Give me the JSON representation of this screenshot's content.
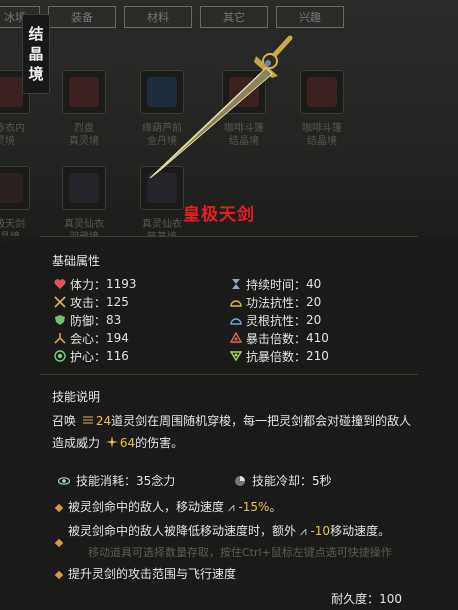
{
  "tabs": [
    "冰境",
    "装备",
    "材料",
    "其它",
    "兴趣"
  ],
  "realm": [
    "结",
    "晶",
    "境"
  ],
  "background_items": [
    {
      "label": "人赤衣内\n灵境"
    },
    {
      "label": "烈盘\n真灵境"
    },
    {
      "label": "缘葫芦前\n金丹境"
    },
    {
      "label": "咖啡斗篷\n结晶境"
    },
    {
      "label": "咖啡斗篷\n结晶境"
    },
    {
      "label": "皇极天剑\n结晶境"
    },
    {
      "label": "真灵仙衣\n羽藏境"
    },
    {
      "label": "真灵仙衣\n筑基境"
    }
  ],
  "item_name": "皇极天剑",
  "base_attr_title": "基础属性",
  "stats_left": [
    {
      "icon": "heart-icon",
      "label": "体力",
      "value": "1193",
      "color": "#e25555"
    },
    {
      "icon": "crossed-swords-icon",
      "label": "攻击",
      "value": "125",
      "color": "#e0b24a"
    },
    {
      "icon": "shield-icon",
      "label": "防御",
      "value": "83",
      "color": "#6fc46f"
    },
    {
      "icon": "triangle-nodes-icon",
      "label": "会心",
      "value": "194",
      "color": "#e39a3a"
    },
    {
      "icon": "protect-heart-icon",
      "label": "护心",
      "value": "116",
      "color": "#7bd07b"
    }
  ],
  "stats_right": [
    {
      "icon": "hourglass-icon",
      "label": "持续时间",
      "value": "40",
      "color": "#8fa6c9"
    },
    {
      "icon": "arc-shield-icon",
      "label": "功法抗性",
      "value": "20",
      "color": "#e0b24a"
    },
    {
      "icon": "spirit-arc-icon",
      "label": "灵根抗性",
      "value": "20",
      "color": "#6fa7e0"
    },
    {
      "icon": "crit-nodes-icon",
      "label": "暴击倍数",
      "value": "410",
      "color": "#e0664a"
    },
    {
      "icon": "anti-crit-icon",
      "label": "抗暴倍数",
      "value": "210",
      "color": "#a6d05a"
    }
  ],
  "skill_title": "技能说明",
  "skill_desc": {
    "pre": "召唤",
    "count": "24",
    "mid": "道灵剑在周围随机穿梭，每一把灵剑都会对碰撞到的敌人造成威力",
    "power": "64",
    "post": "的伤害。"
  },
  "skill_cost": "技能消耗：35念力",
  "skill_cooldown": "技能冷却：5秒",
  "bullets": [
    {
      "pre": "被灵剑命中的敌人，移动速度",
      "val": "-15%",
      "post": "。"
    },
    {
      "pre": "被灵剑命中的敌人被降低移动速度时，额外",
      "val": "-10",
      "post": "移动速度。"
    },
    {
      "pre": "提升灵剑的攻击范围与飞行速度",
      "val": "",
      "post": ""
    }
  ],
  "ghost_text": "移动道具可选择数量存取，按住Ctrl+鼠标左键点选可快捷操作",
  "durability": "耐久度：100",
  "colors": {
    "accent_gold": "#f2c23a",
    "name_red": "#e81e1e",
    "diamond": "#d69a35"
  }
}
